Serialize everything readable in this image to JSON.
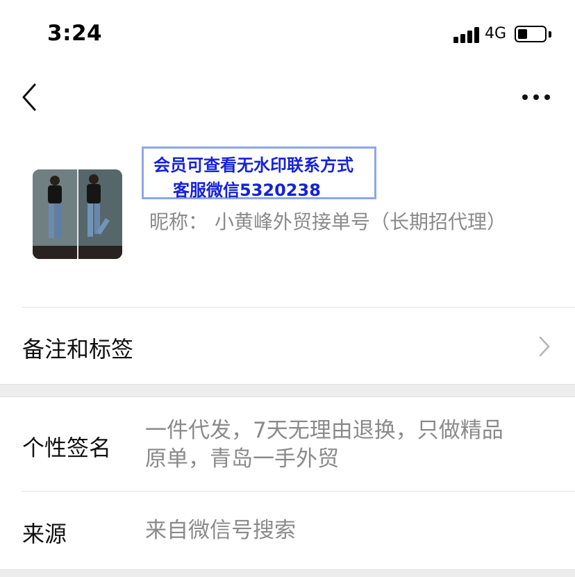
{
  "status_bar": {
    "time": "3:24",
    "network": "4G",
    "battery_level": 0.35
  },
  "nav": {
    "back_icon": "chevron-left-icon",
    "more_icon": "more-dots-icon"
  },
  "profile": {
    "watermark_line1": "会员可查看无水印联系方式",
    "watermark_line2": "客服微信5320238",
    "nickname_label": "昵称：",
    "nickname_value": "小黄峰外贸接单号（长期招代理）"
  },
  "rows": {
    "notes_tags": {
      "label": "备注和标签",
      "icon": "chevron-right-icon"
    },
    "signature": {
      "label": "个性签名",
      "value_line1": "一件代发，7天无理由退换，只做精品",
      "value_line2": "原单，青岛一手外贸"
    },
    "source": {
      "label": "来源",
      "value": "来自微信号搜索"
    }
  },
  "colors": {
    "watermark_text": "#1522d8",
    "watermark_border": "#8ea6e8",
    "secondary_text": "#8a8a8a",
    "section_gap": "#ededed"
  }
}
